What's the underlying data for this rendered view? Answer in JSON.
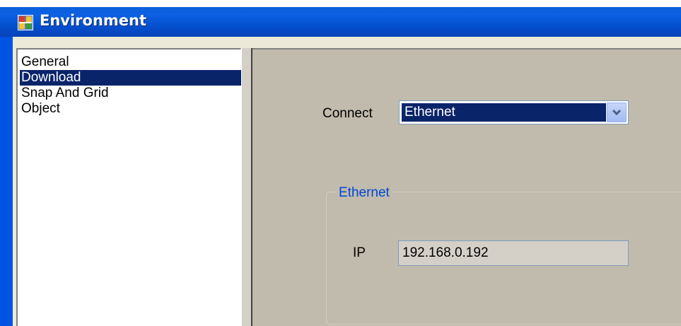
{
  "window": {
    "title": "Environment",
    "icon": "environment-app-icon",
    "titlebar_color": "#0054e3"
  },
  "sidebar": {
    "items": [
      {
        "label": "General",
        "selected": false
      },
      {
        "label": "Download",
        "selected": true
      },
      {
        "label": "Snap And Grid",
        "selected": false
      },
      {
        "label": "Object",
        "selected": false
      }
    ]
  },
  "download": {
    "connect_label": "Connect",
    "connect_value": "Ethernet",
    "dropdown_icon": "chevron-down-icon",
    "ethernet_group": {
      "title": "Ethernet",
      "ip_label": "IP",
      "ip_value": "192.168.0.192"
    }
  },
  "colors": {
    "selection": "#0a246a",
    "panel_bg": "#c0bbac",
    "group_title": "#0046d5"
  }
}
